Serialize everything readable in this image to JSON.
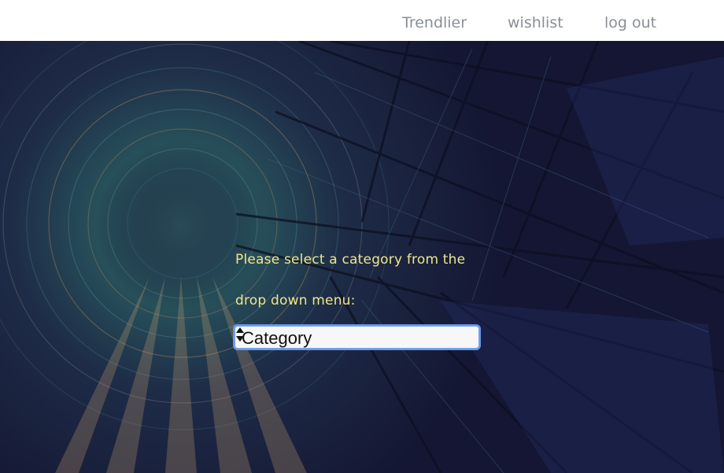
{
  "header": {
    "nav": [
      {
        "label": "Trendlier"
      },
      {
        "label": "wishlist"
      },
      {
        "label": "log out"
      }
    ]
  },
  "main": {
    "prompt_line_1": "Please select a category from the",
    "prompt_line_2": "drop down menu:",
    "category_select": {
      "selected": "Category"
    }
  },
  "colors": {
    "header_bg": "#ffffff",
    "nav_text": "#8a8f96",
    "background": "#151733",
    "prompt_text": "#f1e58a",
    "select_focus": "#6a98e8"
  },
  "icons": [
    "updown-arrows-icon"
  ]
}
